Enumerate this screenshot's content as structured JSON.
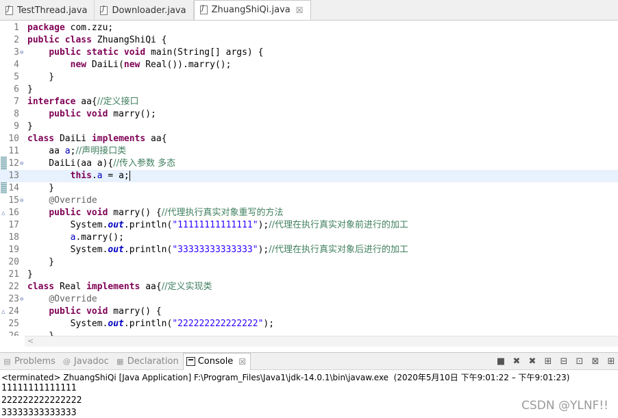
{
  "editor_tabs": [
    {
      "label": "TestThread.java"
    },
    {
      "label": "Downloader.java"
    },
    {
      "label": "ZhuangShiQi.java",
      "close": "☒"
    }
  ],
  "code_lines": [
    {
      "n": "1",
      "html": "<span class='kw'>package</span> com.zzu;"
    },
    {
      "n": "2",
      "html": "<span class='kw'>public</span> <span class='kw'>class</span> ZhuangShiQi {"
    },
    {
      "n": "3",
      "html": "    <span class='kw'>public</span> <span class='kw'>static</span> <span class='kw'>void</span> main(String[] args) {"
    },
    {
      "n": "4",
      "html": "        <span class='kw'>new</span> DaiLi(<span class='kw'>new</span> Real()).marry();"
    },
    {
      "n": "5",
      "html": "    }"
    },
    {
      "n": "6",
      "html": "}"
    },
    {
      "n": "7",
      "html": "<span class='kw'>interface</span> aa{<span class='cm'>//定义接口</span>"
    },
    {
      "n": "8",
      "html": "    <span class='kw'>public</span> <span class='kw'>void</span> marry();"
    },
    {
      "n": "9",
      "html": "}"
    },
    {
      "n": "10",
      "html": "<span class='kw'>class</span> DaiLi <span class='kw'>implements</span> aa{"
    },
    {
      "n": "11",
      "html": "    aa <span class='fld'>a</span>;<span class='cm'>//声明接口类</span>"
    },
    {
      "n": "12",
      "html": "    DaiLi(aa a){<span class='cm'>//传入参数 多态</span>"
    },
    {
      "n": "13",
      "html": "        <span class='kw'>this</span>.<span class='fld'>a</span> = a;<span class='cursor'></span>"
    },
    {
      "n": "14",
      "html": "    }"
    },
    {
      "n": "15",
      "html": "    <span class='ann'>@Override</span>"
    },
    {
      "n": "16",
      "html": "    <span class='kw'>public</span> <span class='kw'>void</span> marry() {<span class='cm'>//代理执行真实对象重写的方法</span>"
    },
    {
      "n": "17",
      "html": "        System.<span class='sfld'>out</span>.println(<span class='str'>\"11111111111111\"</span>);<span class='cm'>//代理在执行真实对象前进行的加工</span>"
    },
    {
      "n": "18",
      "html": "        <span class='fld'>a</span>.marry();"
    },
    {
      "n": "19",
      "html": "        System.<span class='sfld'>out</span>.println(<span class='str'>\"33333333333333\"</span>);<span class='cm'>//代理在执行真实对象后进行的加工</span>"
    },
    {
      "n": "20",
      "html": "    }"
    },
    {
      "n": "21",
      "html": "}"
    },
    {
      "n": "22",
      "html": "<span class='kw'>class</span> Real <span class='kw'>implements</span> aa{<span class='cm'>//定义实现类</span>"
    },
    {
      "n": "23",
      "html": "    <span class='ann'>@Override</span>"
    },
    {
      "n": "24",
      "html": "    <span class='kw'>public</span> <span class='kw'>void</span> marry() {"
    },
    {
      "n": "25",
      "html": "        System.<span class='sfld'>out</span>.println(<span class='str'>\"222222222222222\"</span>);"
    },
    {
      "n": "26",
      "html": "    }"
    }
  ],
  "fold_icon": "⊖",
  "override_icon": "△",
  "panel": {
    "tabs": [
      {
        "label": "Problems",
        "icon": "problems-icon"
      },
      {
        "label": "Javadoc",
        "icon": "javadoc-icon",
        "glyph": "@"
      },
      {
        "label": "Declaration",
        "icon": "declaration-icon"
      },
      {
        "label": "Console",
        "icon": "console-icon",
        "close": "☒"
      }
    ],
    "toolbar": [
      "■",
      "✖",
      "✖",
      "⊞",
      "⊟",
      "⊡",
      "⊠",
      "⊞"
    ],
    "terminated": "<terminated> ZhuangShiQi [Java Application] F:\\Program_Files\\Java1\\jdk-14.0.1\\bin\\javaw.exe  (2020年5月10日 下午9:01:22 – 下午9:01:23)",
    "output": [
      "11111111111111",
      "222222222222222",
      "33333333333333"
    ]
  },
  "watermark": "CSDN @YLNF!!"
}
